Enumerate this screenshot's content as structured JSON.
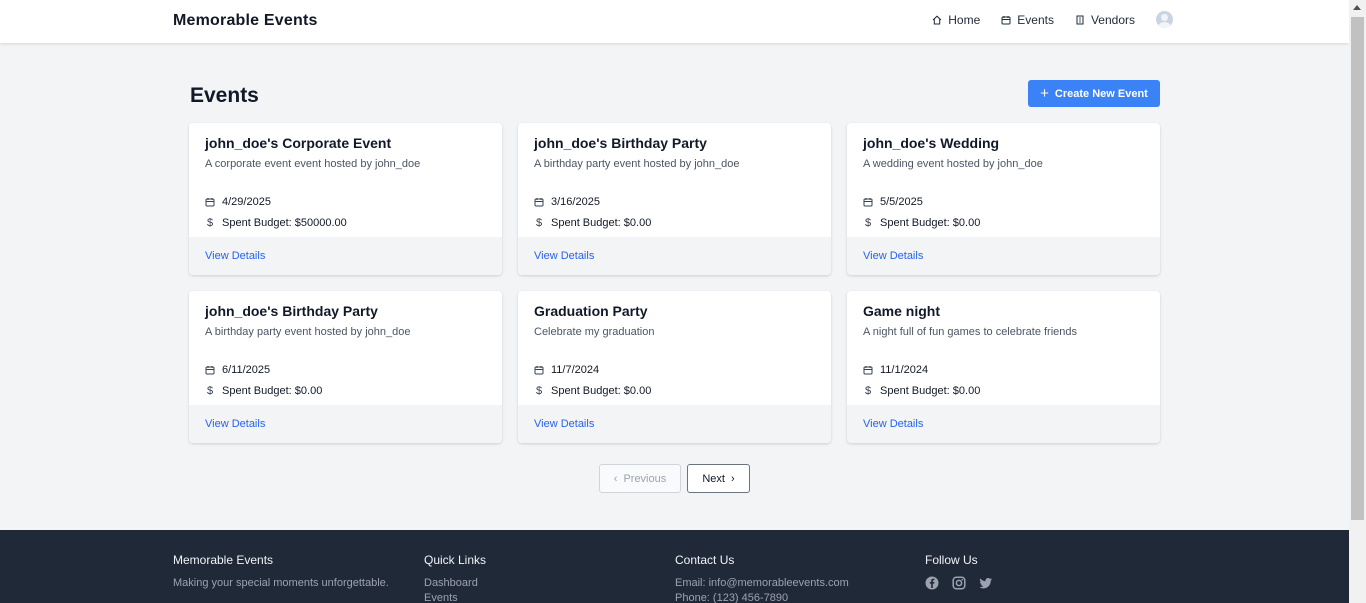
{
  "header": {
    "brand": "Memorable Events",
    "nav": [
      {
        "label": "Home",
        "icon": "home-icon"
      },
      {
        "label": "Events",
        "icon": "calendar-icon"
      },
      {
        "label": "Vendors",
        "icon": "building-icon"
      }
    ]
  },
  "main": {
    "title": "Events",
    "create_label": "Create New Event",
    "view_details": "View Details",
    "events": [
      {
        "title": "john_doe's Corporate Event",
        "description": "A corporate event event hosted by john_doe",
        "date": "4/29/2025",
        "budget": "Spent Budget: $50000.00"
      },
      {
        "title": "john_doe's Birthday Party",
        "description": "A birthday party event hosted by john_doe",
        "date": "3/16/2025",
        "budget": "Spent Budget: $0.00"
      },
      {
        "title": "john_doe's Wedding",
        "description": "A wedding event hosted by john_doe",
        "date": "5/5/2025",
        "budget": "Spent Budget: $0.00"
      },
      {
        "title": "john_doe's Birthday Party",
        "description": "A birthday party event hosted by john_doe",
        "date": "6/11/2025",
        "budget": "Spent Budget: $0.00"
      },
      {
        "title": "Graduation Party",
        "description": "Celebrate my graduation",
        "date": "11/7/2024",
        "budget": "Spent Budget: $0.00"
      },
      {
        "title": "Game night",
        "description": "A night full of fun games to celebrate friends",
        "date": "11/1/2024",
        "budget": "Spent Budget: $0.00"
      }
    ],
    "pagination": {
      "previous": "Previous",
      "next": "Next"
    }
  },
  "footer": {
    "about_title": "Memorable Events",
    "about_text": "Making your special moments unforgettable.",
    "links_title": "Quick Links",
    "links": [
      "Dashboard",
      "Events"
    ],
    "contact_title": "Contact Us",
    "email": "Email: info@memorableevents.com",
    "phone": "Phone: (123) 456-7890",
    "follow_title": "Follow Us",
    "social": [
      "facebook-icon",
      "instagram-icon",
      "twitter-icon"
    ]
  },
  "colors": {
    "accent": "#3b82f6",
    "link": "#2563eb",
    "footer_bg": "#1f2937"
  }
}
